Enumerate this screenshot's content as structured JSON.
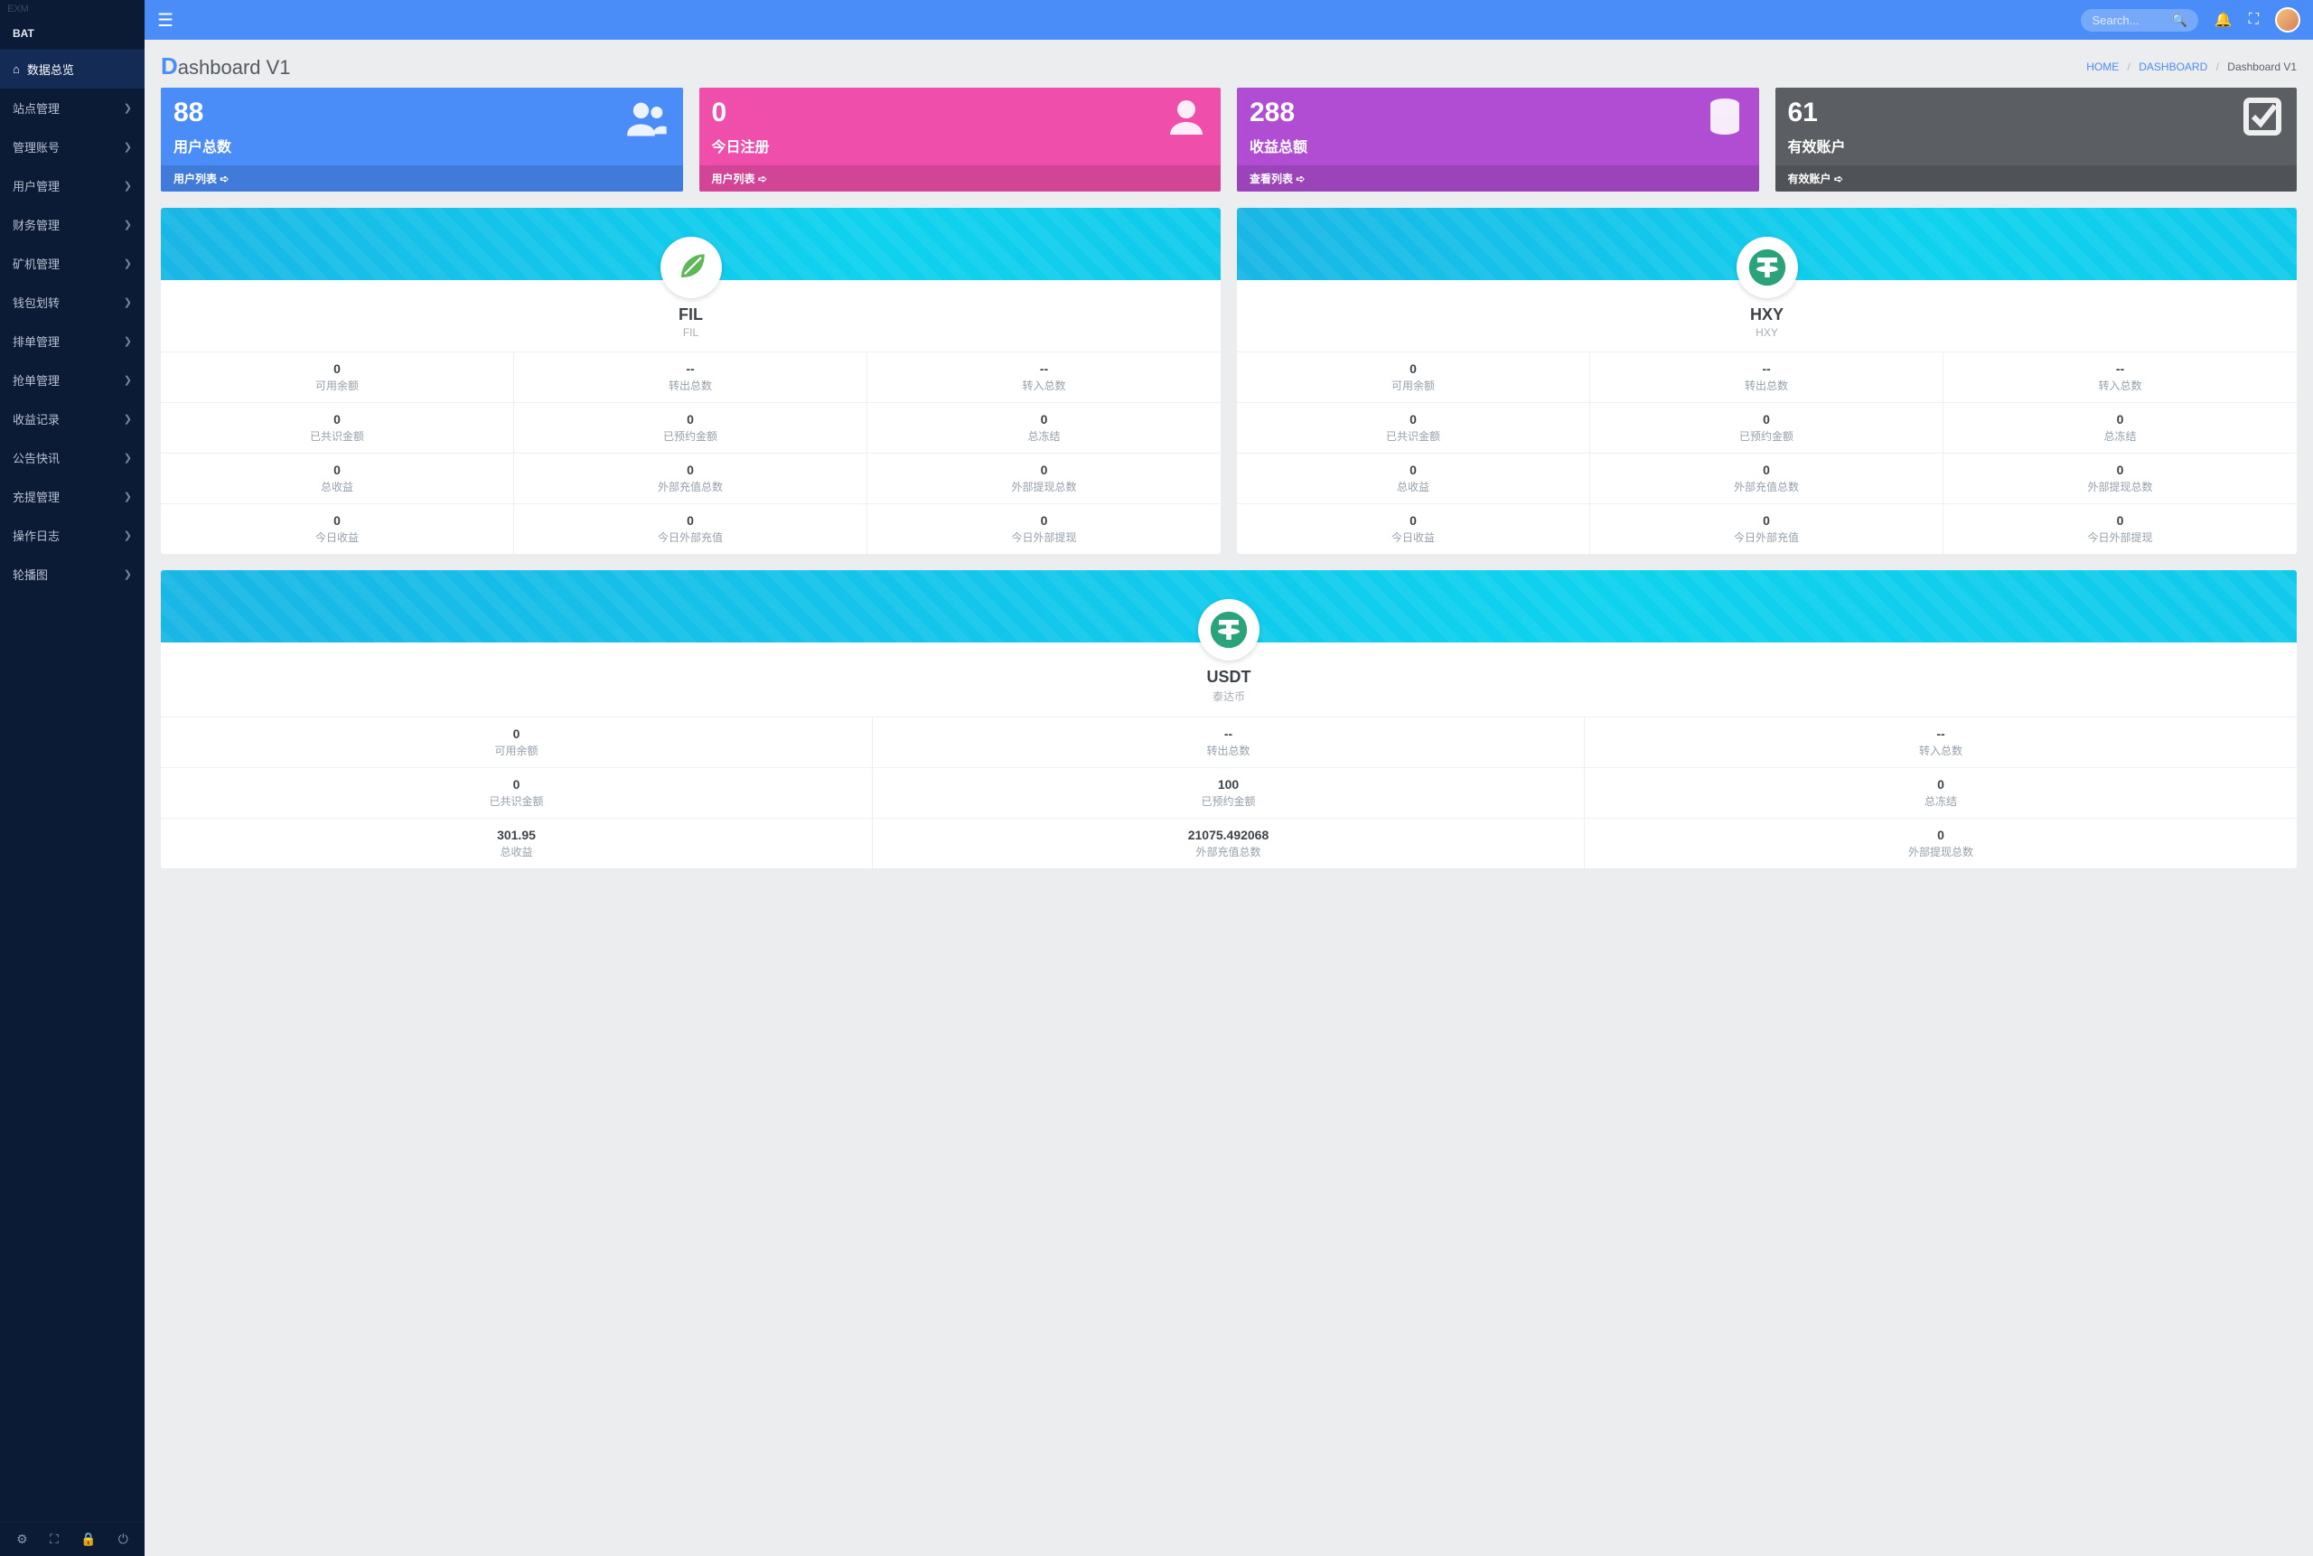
{
  "brand": "EXM",
  "section": "BAT",
  "sidebar": [
    {
      "label": "数据总览",
      "icon": "home",
      "active": true,
      "expandable": false
    },
    {
      "label": "站点管理",
      "expandable": true
    },
    {
      "label": "管理账号",
      "expandable": true
    },
    {
      "label": "用户管理",
      "expandable": true
    },
    {
      "label": "财务管理",
      "expandable": true
    },
    {
      "label": "矿机管理",
      "expandable": true
    },
    {
      "label": "钱包划转",
      "expandable": true
    },
    {
      "label": "排单管理",
      "expandable": true
    },
    {
      "label": "抢单管理",
      "expandable": true
    },
    {
      "label": "收益记录",
      "expandable": true
    },
    {
      "label": "公告快讯",
      "expandable": true
    },
    {
      "label": "充提管理",
      "expandable": true
    },
    {
      "label": "操作日志",
      "expandable": true
    },
    {
      "label": "轮播图",
      "expandable": true
    }
  ],
  "search_placeholder": "Search...",
  "page_title_prefix": "D",
  "page_title_rest": "ashboard V1",
  "breadcrumbs": {
    "home": "HOME",
    "mid": "DASHBOARD",
    "current": "Dashboard V1"
  },
  "stats": [
    {
      "num": "88",
      "label": "用户总数",
      "foot": "用户列表",
      "color": "blue",
      "icon": "users"
    },
    {
      "num": "0",
      "label": "今日注册",
      "foot": "用户列表",
      "color": "pink",
      "icon": "user"
    },
    {
      "num": "288",
      "label": "收益总额",
      "foot": "查看列表",
      "color": "purple",
      "icon": "db"
    },
    {
      "num": "61",
      "label": "有效账户",
      "foot": "有效账户",
      "color": "dark",
      "icon": "check"
    }
  ],
  "coin_labels": {
    "avail": "可用余额",
    "out_total": "转出总数",
    "in_total": "转入总数",
    "recognized": "已共识金额",
    "reserved": "已预约金额",
    "frozen": "总冻结",
    "income": "总收益",
    "ext_deposit": "外部充值总数",
    "ext_withdraw": "外部提现总数",
    "today_income": "今日收益",
    "today_ext_dep": "今日外部充值",
    "today_ext_wd": "今日外部提现"
  },
  "coins": [
    {
      "name": "FIL",
      "sub": "FIL",
      "logo": "leaf",
      "cells": [
        [
          "0",
          "avail"
        ],
        [
          "--",
          "out_total"
        ],
        [
          "--",
          "in_total"
        ],
        [
          "0",
          "recognized"
        ],
        [
          "0",
          "reserved"
        ],
        [
          "0",
          "frozen"
        ],
        [
          "0",
          "income"
        ],
        [
          "0",
          "ext_deposit"
        ],
        [
          "0",
          "ext_withdraw"
        ],
        [
          "0",
          "today_income"
        ],
        [
          "0",
          "today_ext_dep"
        ],
        [
          "0",
          "today_ext_wd"
        ]
      ]
    },
    {
      "name": "HXY",
      "sub": "HXY",
      "logo": "tether",
      "cells": [
        [
          "0",
          "avail"
        ],
        [
          "--",
          "out_total"
        ],
        [
          "--",
          "in_total"
        ],
        [
          "0",
          "recognized"
        ],
        [
          "0",
          "reserved"
        ],
        [
          "0",
          "frozen"
        ],
        [
          "0",
          "income"
        ],
        [
          "0",
          "ext_deposit"
        ],
        [
          "0",
          "ext_withdraw"
        ],
        [
          "0",
          "today_income"
        ],
        [
          "0",
          "today_ext_dep"
        ],
        [
          "0",
          "today_ext_wd"
        ]
      ]
    },
    {
      "name": "USDT",
      "sub": "泰达币",
      "logo": "tether",
      "cells": [
        [
          "0",
          "avail"
        ],
        [
          "--",
          "out_total"
        ],
        [
          "--",
          "in_total"
        ],
        [
          "0",
          "recognized"
        ],
        [
          "100",
          "reserved"
        ],
        [
          "0",
          "frozen"
        ],
        [
          "301.95",
          "income"
        ],
        [
          "21075.492068",
          "ext_deposit"
        ],
        [
          "0",
          "ext_withdraw"
        ]
      ]
    }
  ]
}
